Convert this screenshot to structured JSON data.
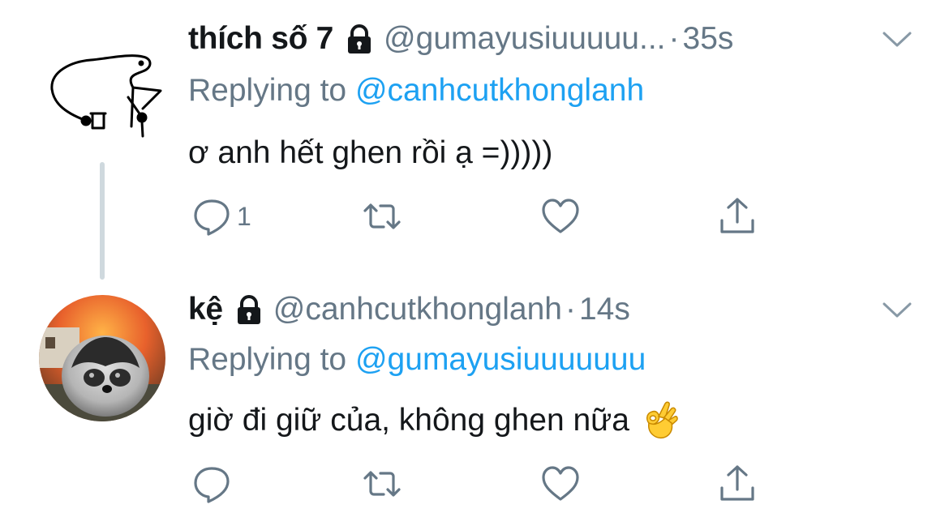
{
  "tweets": [
    {
      "display_name": "thích số 7",
      "handle": "@gumayusiuuuuu...",
      "separator": "·",
      "time": "35s",
      "replying_prefix": "Replying to",
      "replying_to": "@canhcutkhonglanh",
      "text": "ơ anh hết ghen rồi ạ =)))))",
      "reply_count": "1",
      "icons": [
        "lock-icon",
        "caret-down-icon",
        "reply-icon",
        "retweet-icon",
        "like-icon",
        "share-icon"
      ]
    },
    {
      "display_name": "kệ",
      "handle": "@canhcutkhonglanh",
      "separator": "·",
      "time": "14s",
      "replying_prefix": "Replying to",
      "replying_to": "@gumayusiuuuuuuu",
      "text": "giờ đi giữ của, không ghen nữa",
      "emoji": "ok-hand",
      "reply_count": "",
      "icons": [
        "lock-icon",
        "caret-down-icon",
        "reply-icon",
        "retweet-icon",
        "like-icon",
        "share-icon"
      ]
    }
  ],
  "colors": {
    "text_primary": "#14171a",
    "text_secondary": "#657786",
    "link": "#1da1f2",
    "thread_line": "#cfd9de"
  }
}
